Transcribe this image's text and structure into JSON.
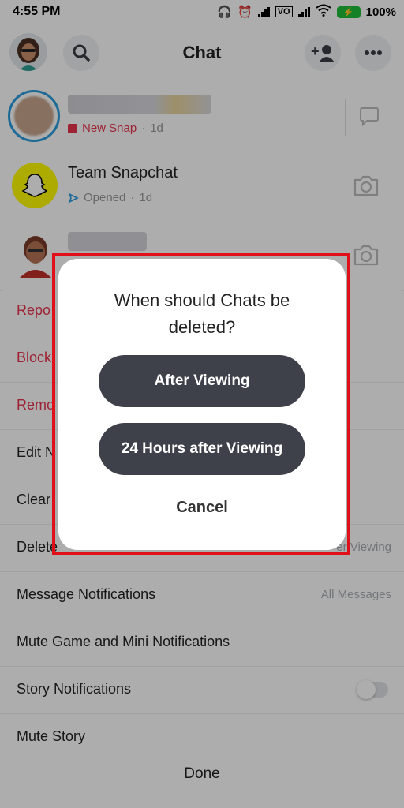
{
  "status_bar": {
    "time": "4:55 PM",
    "battery": "100%"
  },
  "header": {
    "title": "Chat"
  },
  "chats": [
    {
      "status": "New Snap",
      "age": "1d"
    },
    {
      "name": "Team Snapchat",
      "status": "Opened",
      "age": "1d"
    },
    {}
  ],
  "sheet": {
    "items": [
      {
        "label": "Repo"
      },
      {
        "label": "Block"
      },
      {
        "label": "Remo"
      },
      {
        "label": "Edit N"
      },
      {
        "label": "Clear"
      },
      {
        "label": "Delete",
        "value": "er Viewing"
      },
      {
        "label": "Message Notifications",
        "value": "All Messages"
      },
      {
        "label": "Mute Game and Mini Notifications"
      },
      {
        "label": "Story Notifications"
      },
      {
        "label": "Mute Story"
      }
    ],
    "done": "Done"
  },
  "dialog": {
    "title": "When should Chats be deleted?",
    "option1": "After Viewing",
    "option2": "24 Hours after Viewing",
    "cancel": "Cancel"
  },
  "colors": {
    "accent_red": "#e0101a",
    "dark_button": "#3e4149",
    "new_snap": "#e8334d"
  }
}
